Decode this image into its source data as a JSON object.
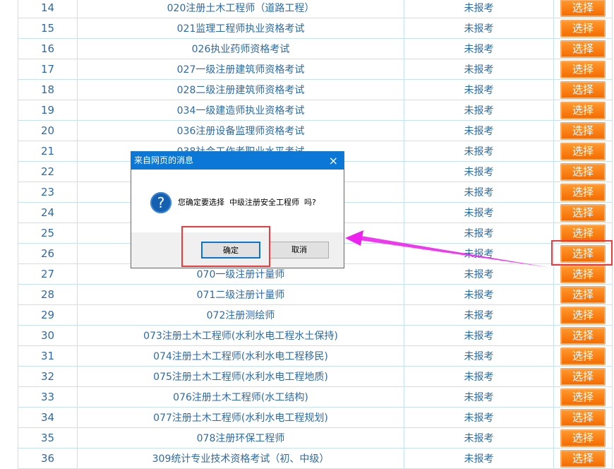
{
  "table": {
    "select_label": "选择",
    "rows": [
      {
        "no": "14",
        "name": "020注册土木工程师（道路工程）",
        "status": "未报考"
      },
      {
        "no": "15",
        "name": "021监理工程师执业资格考试",
        "status": "未报考"
      },
      {
        "no": "16",
        "name": "026执业药师资格考试",
        "status": "未报考"
      },
      {
        "no": "17",
        "name": "027一级注册建筑师资格考试",
        "status": "未报考"
      },
      {
        "no": "18",
        "name": "028二级注册建筑师资格考试",
        "status": "未报考"
      },
      {
        "no": "19",
        "name": "034一级建造师执业资格考试",
        "status": "未报考"
      },
      {
        "no": "20",
        "name": "036注册设备监理师资格考试",
        "status": "未报考"
      },
      {
        "no": "21",
        "name": "038社会工作者职业水平考试",
        "status": "未报考"
      },
      {
        "no": "22",
        "name": "",
        "status": "未报考"
      },
      {
        "no": "23",
        "name": "",
        "status": "未报考"
      },
      {
        "no": "24",
        "name": "",
        "status": "未报考"
      },
      {
        "no": "25",
        "name": "",
        "status": "未报考"
      },
      {
        "no": "26",
        "name": "",
        "status": "未报考"
      },
      {
        "no": "27",
        "name": "070一级注册计量师",
        "status": "未报考"
      },
      {
        "no": "28",
        "name": "071二级注册计量师",
        "status": "未报考"
      },
      {
        "no": "29",
        "name": "072注册测绘师",
        "status": "未报考"
      },
      {
        "no": "30",
        "name": "073注册土木工程师(水利水电工程水土保持)",
        "status": "未报考"
      },
      {
        "no": "31",
        "name": "074注册土木工程师(水利水电工程移民)",
        "status": "未报考"
      },
      {
        "no": "32",
        "name": "075注册土木工程师(水利水电工程地质)",
        "status": "未报考"
      },
      {
        "no": "33",
        "name": "076注册土木工程师(水工结构)",
        "status": "未报考"
      },
      {
        "no": "34",
        "name": "077注册土木工程师(水利水电工程规划)",
        "status": "未报考"
      },
      {
        "no": "35",
        "name": "078注册环保工程师",
        "status": "未报考"
      },
      {
        "no": "36",
        "name": "309统计专业技术资格考试（初、中级）",
        "status": "未报考"
      }
    ]
  },
  "dialog": {
    "title": "来自网页的消息",
    "close_icon": "×",
    "question_icon": "?",
    "message": "您确定要选择  中级注册安全工程师  吗?",
    "ok_label": "确定",
    "cancel_label": "取消"
  },
  "annotations": {
    "highlight_color": "#ee3a3a",
    "arrow_color": "#ee22ee"
  }
}
